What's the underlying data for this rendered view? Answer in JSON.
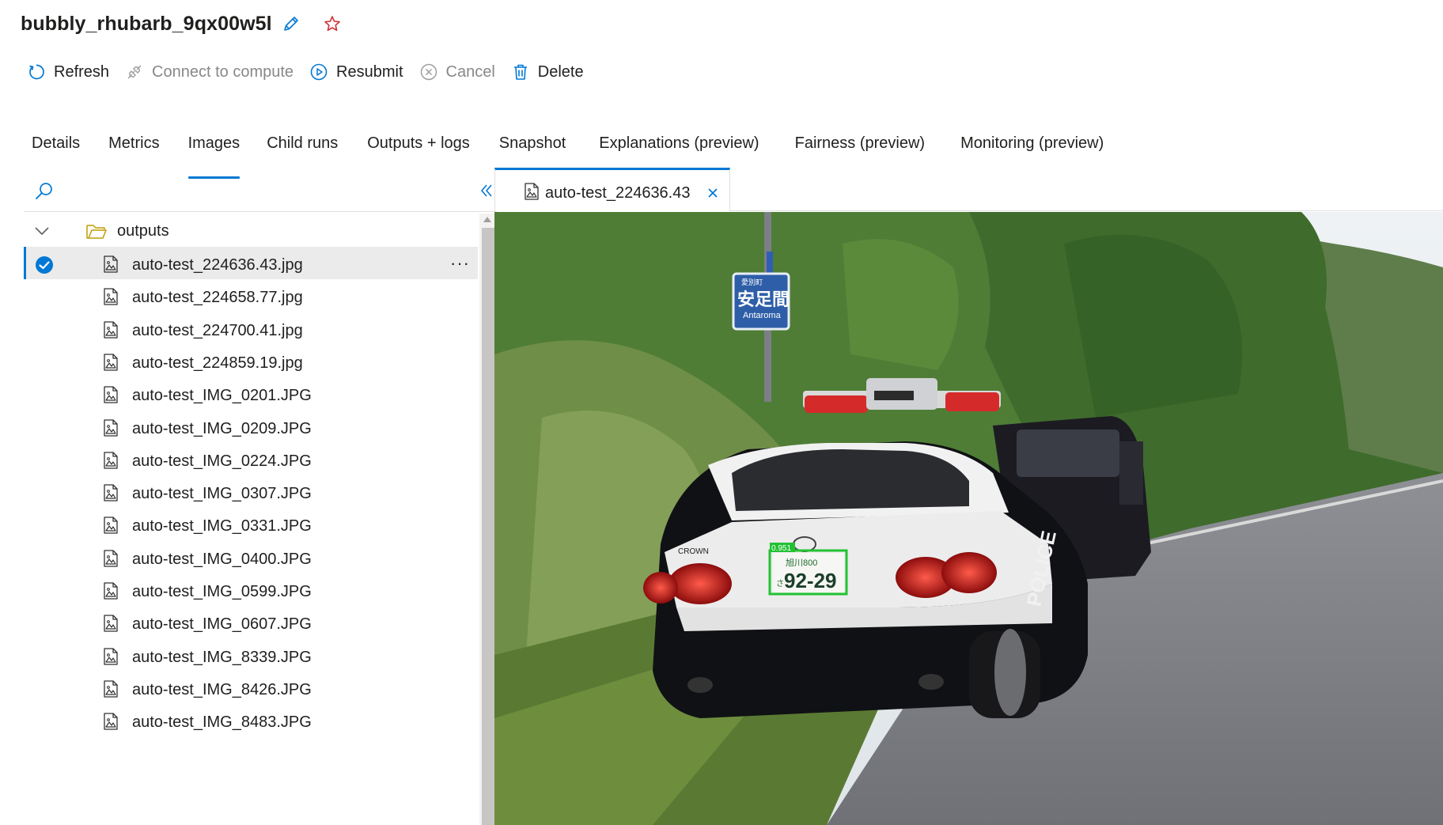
{
  "run": {
    "title": "bubbly_rhubarb_9qx00w5l"
  },
  "toolbar": {
    "refresh": "Refresh",
    "connect": "Connect to compute",
    "resubmit": "Resubmit",
    "cancel": "Cancel",
    "delete": "Delete"
  },
  "tabs": [
    {
      "label": "Details"
    },
    {
      "label": "Metrics"
    },
    {
      "label": "Images"
    },
    {
      "label": "Child runs"
    },
    {
      "label": "Outputs + logs"
    },
    {
      "label": "Snapshot"
    },
    {
      "label": "Explanations (preview)"
    },
    {
      "label": "Fairness (preview)"
    },
    {
      "label": "Monitoring (preview)"
    }
  ],
  "active_tab": "Images",
  "tree": {
    "folder": "outputs",
    "files": [
      "auto-test_224636.43.jpg",
      "auto-test_224658.77.jpg",
      "auto-test_224700.41.jpg",
      "auto-test_224859.19.jpg",
      "auto-test_IMG_0201.JPG",
      "auto-test_IMG_0209.JPG",
      "auto-test_IMG_0224.JPG",
      "auto-test_IMG_0307.JPG",
      "auto-test_IMG_0331.JPG",
      "auto-test_IMG_0400.JPG",
      "auto-test_IMG_0599.JPG",
      "auto-test_IMG_0607.JPG",
      "auto-test_IMG_8339.JPG",
      "auto-test_IMG_8426.JPG",
      "auto-test_IMG_8483.JPG"
    ],
    "selected_index": 0,
    "more": "···"
  },
  "viewer": {
    "tab_label": "auto-test_224636.43",
    "detection_score": "0.951",
    "plate_top": "旭川800",
    "plate_number": "92-29",
    "plate_kana": "さ",
    "sign_small": "愛別町",
    "sign_main": "安足間",
    "sign_romaji": "Antaroma",
    "car_badge": "CROWN",
    "car_side_text": "POLICE"
  },
  "colors": {
    "accent": "#0078d4",
    "detection_box": "#22c232",
    "text": "#201f1e",
    "disabled": "#8a8886"
  }
}
